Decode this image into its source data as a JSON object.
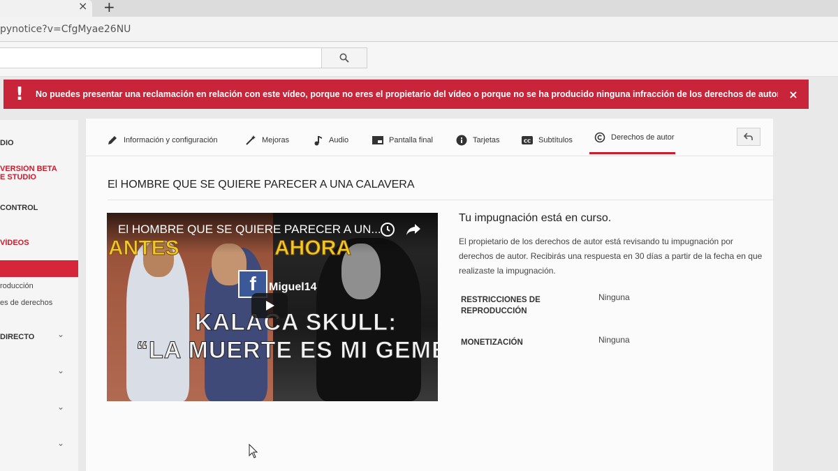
{
  "browser": {
    "tab_close": "×",
    "new_tab": "+",
    "url": "pynotice?v=CfgMyae26NU"
  },
  "header": {
    "search_value": ""
  },
  "alert": {
    "icon": "!",
    "message": "No puedes presentar una reclamación en relación con este vídeo, porque no eres el propietario del vídeo o porque no se ha producido ninguna infracción de los derechos de autor.",
    "close": "×"
  },
  "sidebar": {
    "items": [
      {
        "label": "DIO"
      },
      {
        "label": "VERSIÓN BETA"
      },
      {
        "label": "E STUDIO"
      },
      {
        "label": "CONTROL"
      },
      {
        "label": "VÍDEOS"
      },
      {
        "label": "roducción"
      },
      {
        "label": "es de derechos"
      },
      {
        "label": "DIRECTO"
      }
    ],
    "chevron": "⌄"
  },
  "tabs": [
    {
      "label": "Información y configuración",
      "icon": "pencil-icon"
    },
    {
      "label": "Mejoras",
      "icon": "magic-wand-icon"
    },
    {
      "label": "Audio",
      "icon": "music-note-icon"
    },
    {
      "label": "Pantalla final",
      "icon": "end-screen-icon"
    },
    {
      "label": "Tarjetas",
      "icon": "info-icon"
    },
    {
      "label": "Subtítulos",
      "icon": "cc-icon"
    },
    {
      "label": "Derechos de autor",
      "icon": "copyright-icon"
    }
  ],
  "video": {
    "title": "El HOMBRE QUE SE QUIERE PARECER A UNA CALAVERA",
    "thumbnail": {
      "overlay_title": "El HOMBRE QUE SE QUIERE PARECER A UN...",
      "label_left": "ANTES",
      "label_right": "AHORA",
      "fb_letter": "f",
      "username": "Miguel14",
      "line1": "KALACA SKULL:",
      "line2": "“LA MUERTE ES MI GEMELA”"
    }
  },
  "dispute": {
    "status": "Tu impugnación está en curso.",
    "description": "El propietario de los derechos de autor está revisando tu impugnación por derechos de autor. Recibirás una respuesta en 30 días a partir de la fecha en que realizaste la impugnación.",
    "rows": [
      {
        "label": "RESTRICCIONES DE REPRODUCCIÓN",
        "value": "Ninguna"
      },
      {
        "label": "MONETIZACIÓN",
        "value": "Ninguna"
      }
    ]
  },
  "colors": {
    "alert_red": "#c8243a",
    "accent_red": "#cc1b2b",
    "facebook_blue": "#3b5998"
  }
}
